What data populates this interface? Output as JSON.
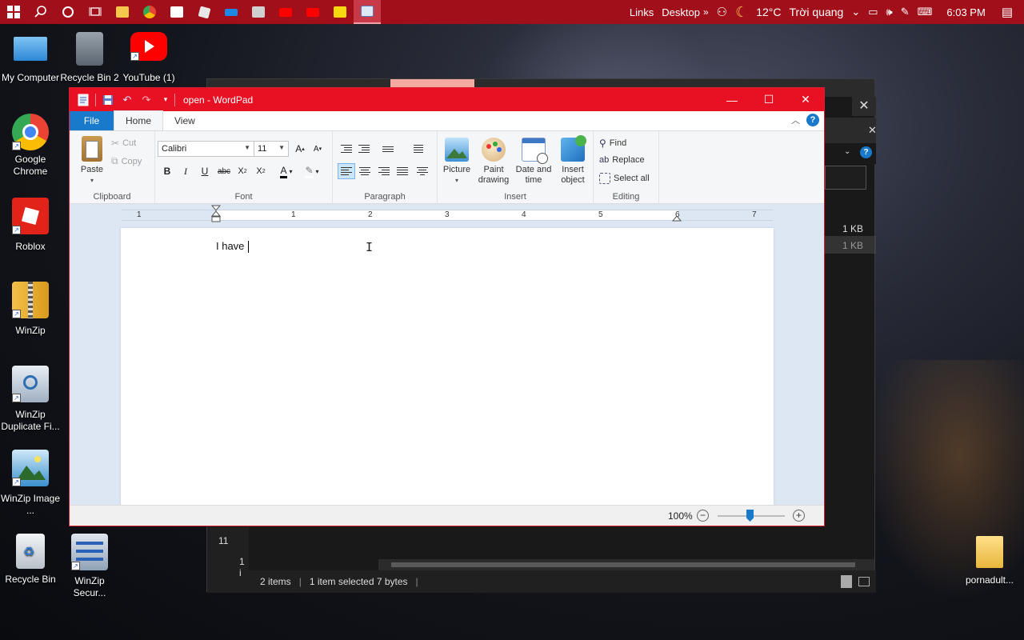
{
  "taskbar": {
    "links_label": "Links",
    "desktop_label": "Desktop",
    "weather": "12°C",
    "weather_desc": "Trời quang",
    "time": "6:03 PM"
  },
  "desktop_icons": [
    {
      "label": "My Computer"
    },
    {
      "label": "Recycle Bin 2"
    },
    {
      "label": "YouTube (1)"
    },
    {
      "label": "Google Chrome"
    },
    {
      "label": "Roblox"
    },
    {
      "label": "WinZip"
    },
    {
      "label": "WinZip Duplicate Fi..."
    },
    {
      "label": "WinZip Image ..."
    },
    {
      "label": "Recycle Bin"
    },
    {
      "label": "WinZip Secur..."
    },
    {
      "label": "pornadult..."
    }
  ],
  "explorer": {
    "status_items": "2 items",
    "status_selected": "1 item selected  7 bytes",
    "sizes": [
      "1 KB",
      "1 KB"
    ],
    "partial_a": "11",
    "partial_b": "1 i"
  },
  "wordpad": {
    "title": "open - WordPad",
    "tabs": {
      "file": "File",
      "home": "Home",
      "view": "View"
    },
    "clipboard": {
      "paste": "Paste",
      "cut": "Cut",
      "copy": "Copy",
      "label": "Clipboard"
    },
    "font": {
      "family": "Calibri",
      "size": "11",
      "label": "Font"
    },
    "paragraph": {
      "label": "Paragraph"
    },
    "insert": {
      "picture": "Picture",
      "paint": "Paint drawing",
      "datetime": "Date and time",
      "object": "Insert object",
      "label": "Insert"
    },
    "editing": {
      "find": "Find",
      "replace": "Replace",
      "select_all": "Select all",
      "label": "Editing"
    },
    "ruler_numbers": [
      "1",
      "1",
      "2",
      "3",
      "4",
      "5",
      "6",
      "7"
    ],
    "document_text": "I have ",
    "zoom": "100%"
  }
}
